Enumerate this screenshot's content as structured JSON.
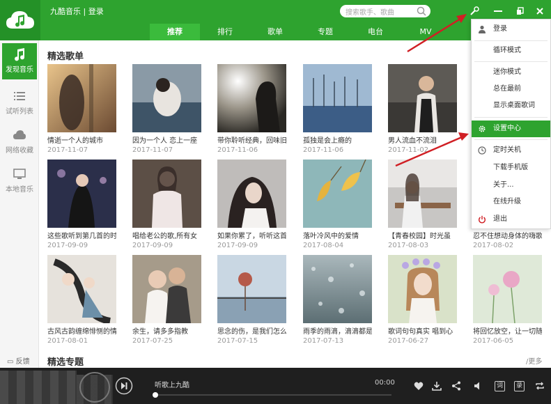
{
  "app": {
    "title": "九酷音乐 | 登录"
  },
  "search": {
    "placeholder": "搜索歌手、歌曲"
  },
  "tabs": [
    {
      "label": "推荐",
      "active": true
    },
    {
      "label": "排行"
    },
    {
      "label": "歌单"
    },
    {
      "label": "专题"
    },
    {
      "label": "电台"
    },
    {
      "label": "MV"
    }
  ],
  "sidebar": {
    "items": [
      {
        "label": "发现音乐",
        "icon": "music-note-icon",
        "active": true
      },
      {
        "label": "试听列表",
        "icon": "list-icon"
      },
      {
        "label": "网络收藏",
        "icon": "cloud-icon"
      },
      {
        "label": "本地音乐",
        "icon": "monitor-icon"
      }
    ],
    "feedback": "反馈"
  },
  "sections": {
    "playlists_title": "精选歌单",
    "topics_title": "精选专题",
    "more": "/更多"
  },
  "playlists": [
    {
      "title": "情逝一个人的城市",
      "date": "2017-11-07"
    },
    {
      "title": "因为一个人 恋上一座",
      "date": "2017-11-07"
    },
    {
      "title": "带你聆听经典，回味旧",
      "date": "2017-11-06"
    },
    {
      "title": "孤独是会上瘾的",
      "date": "2017-11-06"
    },
    {
      "title": "男人流血不流泪",
      "date": "2017-11-02"
    },
    {
      "title": "这些歌听到第几首的时",
      "date": "2017-09-09"
    },
    {
      "title": "唱给老公的歌,所有女",
      "date": "2017-09-09"
    },
    {
      "title": "如果你累了，听听这首",
      "date": "2017-09-09"
    },
    {
      "title": "落叶冷风中的爱情",
      "date": "2017-08-04"
    },
    {
      "title": "【青春校园】时光虽",
      "date": "2017-08-03"
    },
    {
      "title": "忍不住想动身体的嗨歌",
      "date": "2017-08-02"
    },
    {
      "title": "古风古韵缠绵悱恻的情",
      "date": "2017-08-01"
    },
    {
      "title": "余生，请多多指教",
      "date": "2017-07-25"
    },
    {
      "title": "思念的伤，是我们怎么",
      "date": "2017-07-15"
    },
    {
      "title": "雨季的雨滴，滴滴都是",
      "date": "2017-07-13"
    },
    {
      "title": "歌词句句真实 唱到心",
      "date": "2017-06-27"
    },
    {
      "title": "将回忆放空，让一切随",
      "date": "2017-06-05"
    }
  ],
  "menu": {
    "items": [
      {
        "label": "登录",
        "icon": "user-icon"
      },
      {
        "label": "循环模式"
      },
      {
        "label": "迷你模式"
      },
      {
        "label": "总在最前"
      },
      {
        "label": "显示桌面歌词"
      },
      {
        "label": "设置中心",
        "icon": "gear-icon",
        "highlighted": true
      },
      {
        "label": "定时关机",
        "icon": "clock-icon"
      },
      {
        "label": "下载手机版"
      },
      {
        "label": "关于..."
      },
      {
        "label": "在线升级"
      },
      {
        "label": "退出",
        "icon": "power-icon"
      }
    ]
  },
  "player": {
    "song": "听歌上九酷",
    "time": "00:00",
    "progress": 0,
    "buttons": {
      "lyrics": "词",
      "sound": "录"
    }
  },
  "colors": {
    "brand_green": "#2ea32f",
    "brand_green_dark": "#249127",
    "annotation_red": "#d01f24"
  }
}
